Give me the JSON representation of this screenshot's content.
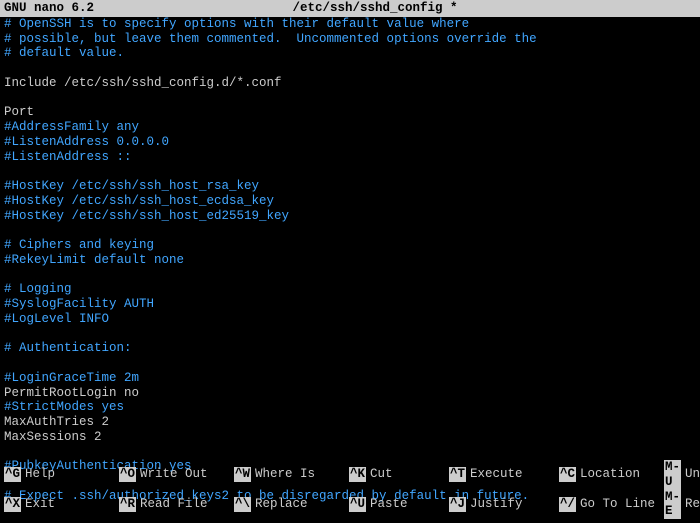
{
  "titlebar": {
    "app": "GNU nano 6.2",
    "file": "/etc/ssh/sshd_config *"
  },
  "lines": [
    {
      "cls": "comment",
      "t": "# OpenSSH is to specify options with their default value where"
    },
    {
      "cls": "comment",
      "t": "# possible, but leave them commented.  Uncommented options override the"
    },
    {
      "cls": "comment",
      "t": "# default value."
    },
    {
      "cls": "normal",
      "t": ""
    },
    {
      "cls": "normal",
      "t": "Include /etc/ssh/sshd_config.d/*.conf"
    },
    {
      "cls": "normal",
      "t": ""
    },
    {
      "cls": "normal",
      "t": "Port"
    },
    {
      "cls": "comment",
      "t": "#AddressFamily any"
    },
    {
      "cls": "comment",
      "t": "#ListenAddress 0.0.0.0"
    },
    {
      "cls": "comment",
      "t": "#ListenAddress ::"
    },
    {
      "cls": "normal",
      "t": ""
    },
    {
      "cls": "comment",
      "t": "#HostKey /etc/ssh/ssh_host_rsa_key"
    },
    {
      "cls": "comment",
      "t": "#HostKey /etc/ssh/ssh_host_ecdsa_key"
    },
    {
      "cls": "comment",
      "t": "#HostKey /etc/ssh/ssh_host_ed25519_key"
    },
    {
      "cls": "normal",
      "t": ""
    },
    {
      "cls": "comment",
      "t": "# Ciphers and keying"
    },
    {
      "cls": "comment",
      "t": "#RekeyLimit default none"
    },
    {
      "cls": "normal",
      "t": ""
    },
    {
      "cls": "comment",
      "t": "# Logging"
    },
    {
      "cls": "comment",
      "t": "#SyslogFacility AUTH"
    },
    {
      "cls": "comment",
      "t": "#LogLevel INFO"
    },
    {
      "cls": "normal",
      "t": ""
    },
    {
      "cls": "comment",
      "t": "# Authentication:"
    },
    {
      "cls": "normal",
      "t": ""
    },
    {
      "cls": "comment",
      "t": "#LoginGraceTime 2m"
    },
    {
      "cls": "normal",
      "t": "PermitRootLogin no"
    },
    {
      "cls": "comment",
      "t": "#StrictModes yes"
    },
    {
      "cls": "normal",
      "t": "MaxAuthTries 2"
    },
    {
      "cls": "normal",
      "t": "MaxSessions 2"
    },
    {
      "cls": "normal",
      "t": ""
    },
    {
      "cls": "comment",
      "t": "#PubkeyAuthentication yes"
    },
    {
      "cls": "normal",
      "t": ""
    },
    {
      "cls": "comment",
      "t": "# Expect .ssh/authorized_keys2 to be disregarded by default in future."
    }
  ],
  "menu": {
    "row1": [
      {
        "key": "^G",
        "label": "Help"
      },
      {
        "key": "^O",
        "label": "Write Out"
      },
      {
        "key": "^W",
        "label": "Where Is"
      },
      {
        "key": "^K",
        "label": "Cut"
      },
      {
        "key": "^T",
        "label": "Execute"
      },
      {
        "key": "^C",
        "label": "Location"
      },
      {
        "key": "M-U",
        "label": "Undo"
      }
    ],
    "row2": [
      {
        "key": "^X",
        "label": "Exit"
      },
      {
        "key": "^R",
        "label": "Read File"
      },
      {
        "key": "^\\",
        "label": "Replace"
      },
      {
        "key": "^U",
        "label": "Paste"
      },
      {
        "key": "^J",
        "label": "Justify"
      },
      {
        "key": "^/",
        "label": "Go To Line"
      },
      {
        "key": "M-E",
        "label": "Redo"
      }
    ]
  }
}
